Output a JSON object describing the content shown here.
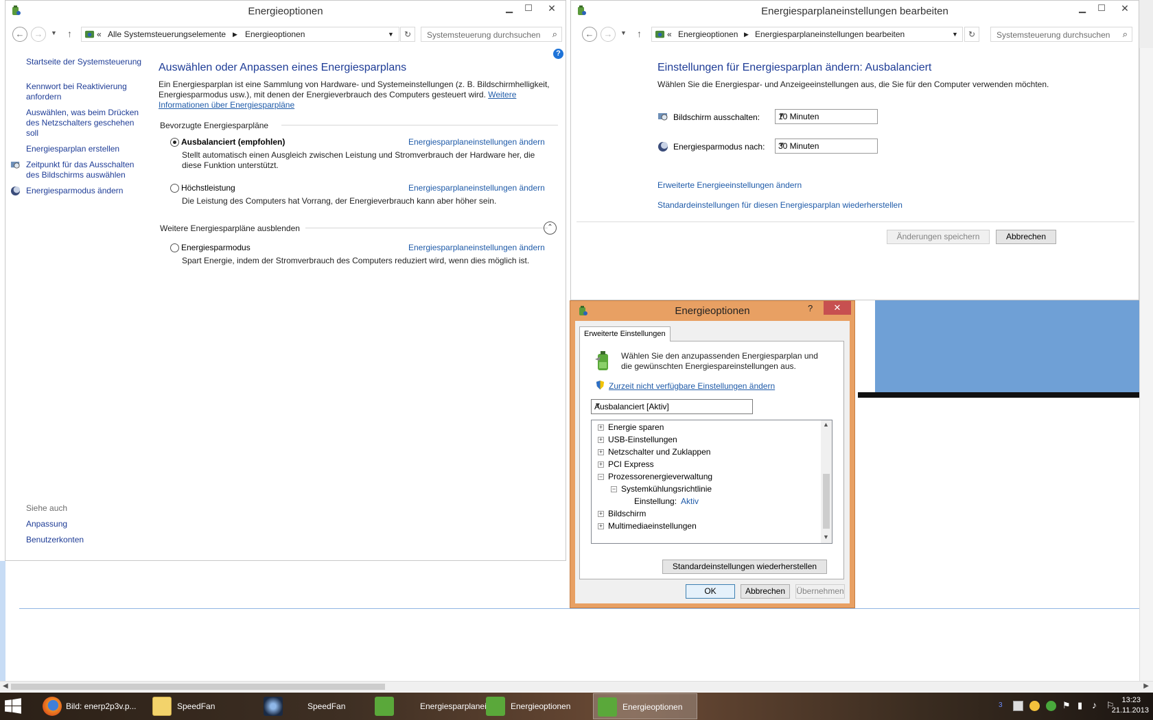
{
  "left_window": {
    "title": "Energieoptionen",
    "breadcrumb": [
      "«",
      "Alle Systemsteuerungselemente",
      "Energieoptionen"
    ],
    "search_placeholder": "Systemsteuerung durchsuchen",
    "sidebar": [
      {
        "label": "Startseite der Systemsteuerung"
      },
      {
        "label": "Kennwort bei Reaktivierung anfordern"
      },
      {
        "label": "Auswählen, was beim Drücken des Netzschalters geschehen soll"
      },
      {
        "label": "Energiesparplan erstellen"
      },
      {
        "label": "Zeitpunkt für das Ausschalten des Bildschirms auswählen"
      },
      {
        "label": "Energiesparmodus ändern"
      }
    ],
    "see_also": {
      "heading": "Siehe auch",
      "items": [
        "Anpassung",
        "Benutzerkonten"
      ]
    },
    "main": {
      "heading": "Auswählen oder Anpassen eines Energiesparplans",
      "intro": "Ein Energiesparplan ist eine Sammlung von Hardware- und Systemeinstellungen (z. B. Bildschirmhelligkeit, Energiesparmodus usw.), mit denen der Energieverbrauch des Computers gesteuert wird.",
      "intro_link": "Weitere Informationen über Energiesparpläne",
      "preferred_heading": "Bevorzugte Energiesparpläne",
      "hide_heading": "Weitere Energiesparpläne ausblenden",
      "change_link": "Energiesparplaneinstellungen ändern",
      "plans": [
        {
          "name": "Ausbalanciert (empfohlen)",
          "desc": "Stellt automatisch einen Ausgleich zwischen Leistung und Stromverbrauch der Hardware her, die diese Funktion unterstützt.",
          "selected": true
        },
        {
          "name": "Höchstleistung",
          "desc": "Die Leistung des Computers hat Vorrang, der Energieverbrauch kann aber höher sein.",
          "selected": false
        },
        {
          "name": "Energiesparmodus",
          "desc": "Spart Energie, indem der Stromverbrauch des Computers reduziert wird, wenn dies möglich ist.",
          "selected": false
        }
      ]
    }
  },
  "right_window": {
    "title": "Energiesparplaneinstellungen bearbeiten",
    "breadcrumb": [
      "«",
      "Energieoptionen",
      "Energiesparplaneinstellungen bearbeiten"
    ],
    "search_placeholder": "Systemsteuerung durchsuchen",
    "heading": "Einstellungen für Energiesparplan ändern: Ausbalanciert",
    "subtitle": "Wählen Sie die Energiespar- und Anzeigeeinstellungen aus, die Sie für den Computer verwenden möchten.",
    "display_label": "Bildschirm ausschalten:",
    "display_value": "10 Minuten",
    "sleep_label": "Energiesparmodus nach:",
    "sleep_value": "30 Minuten",
    "advanced_link": "Erweiterte Energieeinstellungen ändern",
    "restore_link": "Standardeinstellungen für diesen Energiesparplan wiederherstellen",
    "save_button": "Änderungen speichern",
    "cancel_button": "Abbrechen"
  },
  "dialog": {
    "title": "Energieoptionen",
    "help": "?",
    "tab": "Erweiterte Einstellungen",
    "intro": "Wählen Sie den anzupassenden Energiesparplan und die gewünschten Energiespareinstellungen aus.",
    "unavailable_link": "Zurzeit nicht verfügbare Einstellungen ändern",
    "plan_value": "Ausbalanciert [Aktiv]",
    "tree": [
      {
        "label": "Energie sparen",
        "sign": "+",
        "level": 0
      },
      {
        "label": "USB-Einstellungen",
        "sign": "+",
        "level": 0
      },
      {
        "label": "Netzschalter und Zuklappen",
        "sign": "+",
        "level": 0
      },
      {
        "label": "PCI Express",
        "sign": "+",
        "level": 0
      },
      {
        "label": "Prozessorenergieverwaltung",
        "sign": "−",
        "level": 0
      },
      {
        "label": "Systemkühlungsrichtlinie",
        "sign": "−",
        "level": 1
      },
      {
        "label": "Einstellung:",
        "value": "Aktiv",
        "level": 2
      },
      {
        "label": "Bildschirm",
        "sign": "+",
        "level": 0
      },
      {
        "label": "Multimediaeinstellungen",
        "sign": "+",
        "level": 0
      }
    ],
    "restore_button": "Standardeinstellungen wiederherstellen",
    "ok_button": "OK",
    "cancel_button": "Abbrechen",
    "apply_button": "Übernehmen"
  },
  "taskbar": {
    "items": [
      {
        "label": "Bild: enerp2p3v.p...",
        "icon": "firefox-icon"
      },
      {
        "label": "SpeedFan",
        "icon": "folder-icon"
      },
      {
        "label": "SpeedFan",
        "icon": "speedfan-icon"
      },
      {
        "label": "Energiesparplanei...",
        "icon": "power-options-icon"
      },
      {
        "label": "Energieoptionen",
        "icon": "power-options-icon"
      },
      {
        "label": "Energieoptionen",
        "icon": "power-options-icon"
      }
    ],
    "time": "13:23",
    "date": "21.11.2013"
  },
  "colors": {
    "link": "#1e5aa8",
    "heading": "#1e3c96",
    "dialog_frame": "#e8a063",
    "taskbar": "#3e2f23"
  }
}
